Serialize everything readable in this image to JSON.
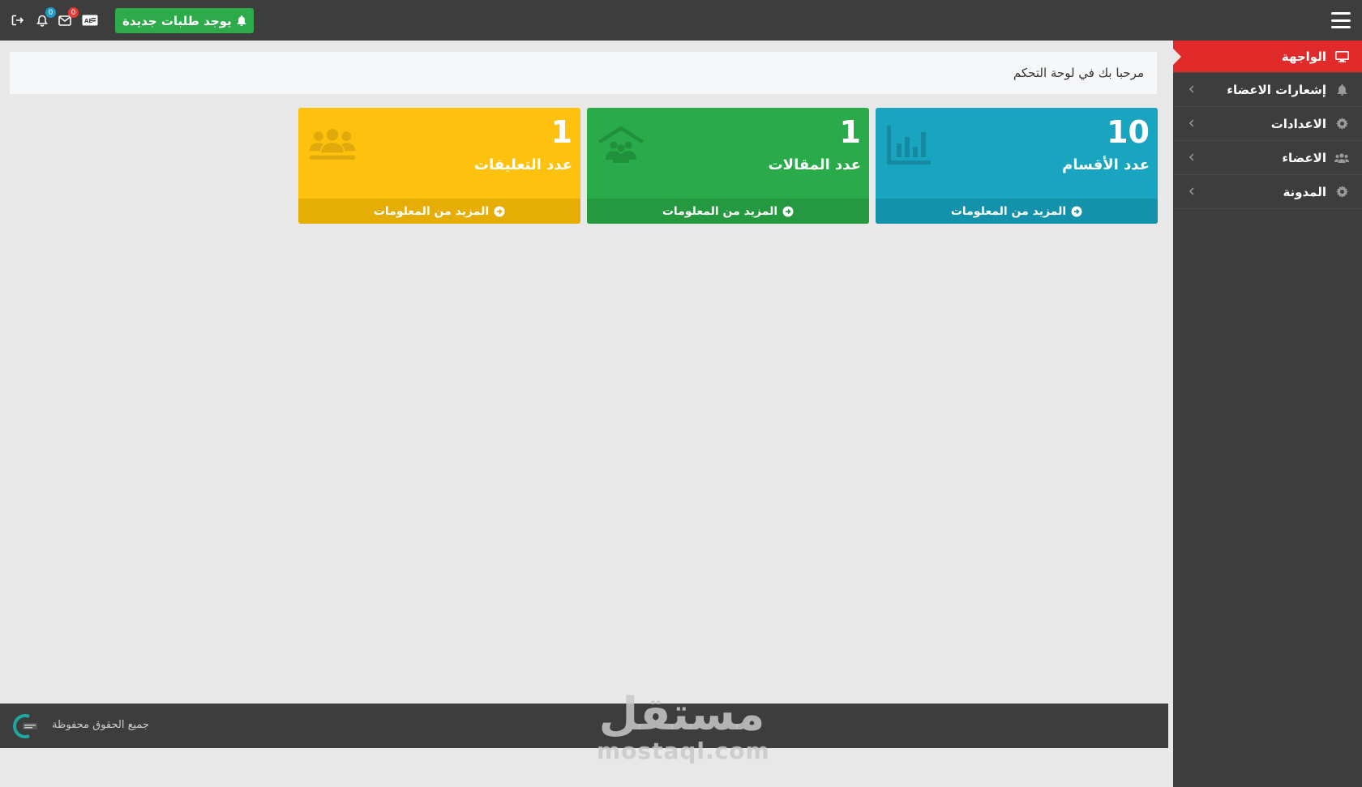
{
  "topbar": {
    "new_requests_label": "يوجد طلبات جديدة",
    "messages_count": "0",
    "notifications_count": "0"
  },
  "sidebar": {
    "items": [
      {
        "label": "الواجهة",
        "icon": "monitor-icon"
      },
      {
        "label": "إشعارات الاعضاء",
        "icon": "bell-icon"
      },
      {
        "label": "الاعدادات",
        "icon": "gear-icon"
      },
      {
        "label": "الاعضاء",
        "icon": "users-icon"
      },
      {
        "label": "المدونة",
        "icon": "gear-icon"
      }
    ]
  },
  "welcome": {
    "text": "مرحبا بك في لوحة التحكم"
  },
  "cards": [
    {
      "value": "10",
      "label": "عدد الأقسام",
      "more": "المزيد من المعلومات",
      "color": "#19a4bf",
      "icon": "chart-icon"
    },
    {
      "value": "1",
      "label": "عدد المقالات",
      "more": "المزيد من المعلومات",
      "color": "#2aab49",
      "icon": "house-people-icon"
    },
    {
      "value": "1",
      "label": "عدد التعليقات",
      "more": "المزيد من المعلومات",
      "color": "#fdc10e",
      "icon": "users-group-icon"
    }
  ],
  "footer": {
    "copyright": "جميع الحقوق محفوظة"
  },
  "watermark": {
    "arabic": "مستقل",
    "latin": "mostaql.com"
  }
}
